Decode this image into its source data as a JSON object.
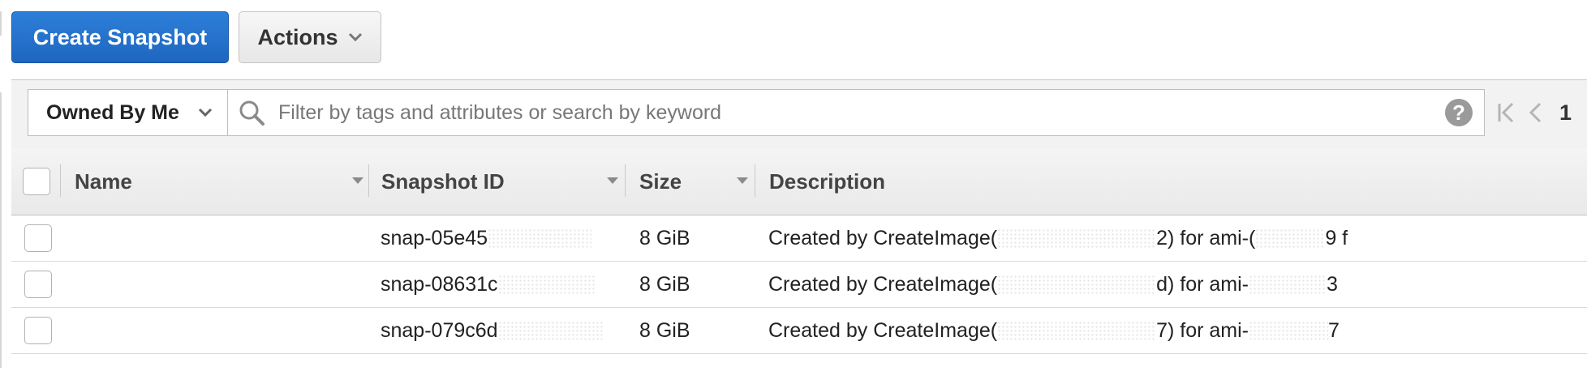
{
  "toolbar": {
    "create_label": "Create Snapshot",
    "actions_label": "Actions"
  },
  "filter": {
    "owner_label": "Owned By Me",
    "search_placeholder": "Filter by tags and attributes or search by keyword",
    "help_symbol": "?"
  },
  "pagination": {
    "current_page": "1"
  },
  "columns": {
    "name": "Name",
    "snapshot_id": "Snapshot ID",
    "size": "Size",
    "description": "Description"
  },
  "rows": [
    {
      "snapshot_id": "snap-05e45",
      "size": "8 GiB",
      "description_start": "Created by CreateImage(",
      "description_mid": "2) for ami-(",
      "description_end": "9 f"
    },
    {
      "snapshot_id": "snap-08631c",
      "size": "8 GiB",
      "description_start": "Created by CreateImage(",
      "description_mid": "d) for ami-",
      "description_end": "3"
    },
    {
      "snapshot_id": "snap-079c6d",
      "size": "8 GiB",
      "description_start": "Created by CreateImage(",
      "description_mid": "7) for ami-",
      "description_end": "7"
    }
  ],
  "colors": {
    "primary_button": "#1e66c0",
    "header_bg": "#ececec",
    "border": "#c6c6c6"
  },
  "icons": [
    "chevron-down-icon",
    "search-icon",
    "help-icon",
    "first-page-icon",
    "prev-page-icon",
    "sort-caret-icon"
  ]
}
